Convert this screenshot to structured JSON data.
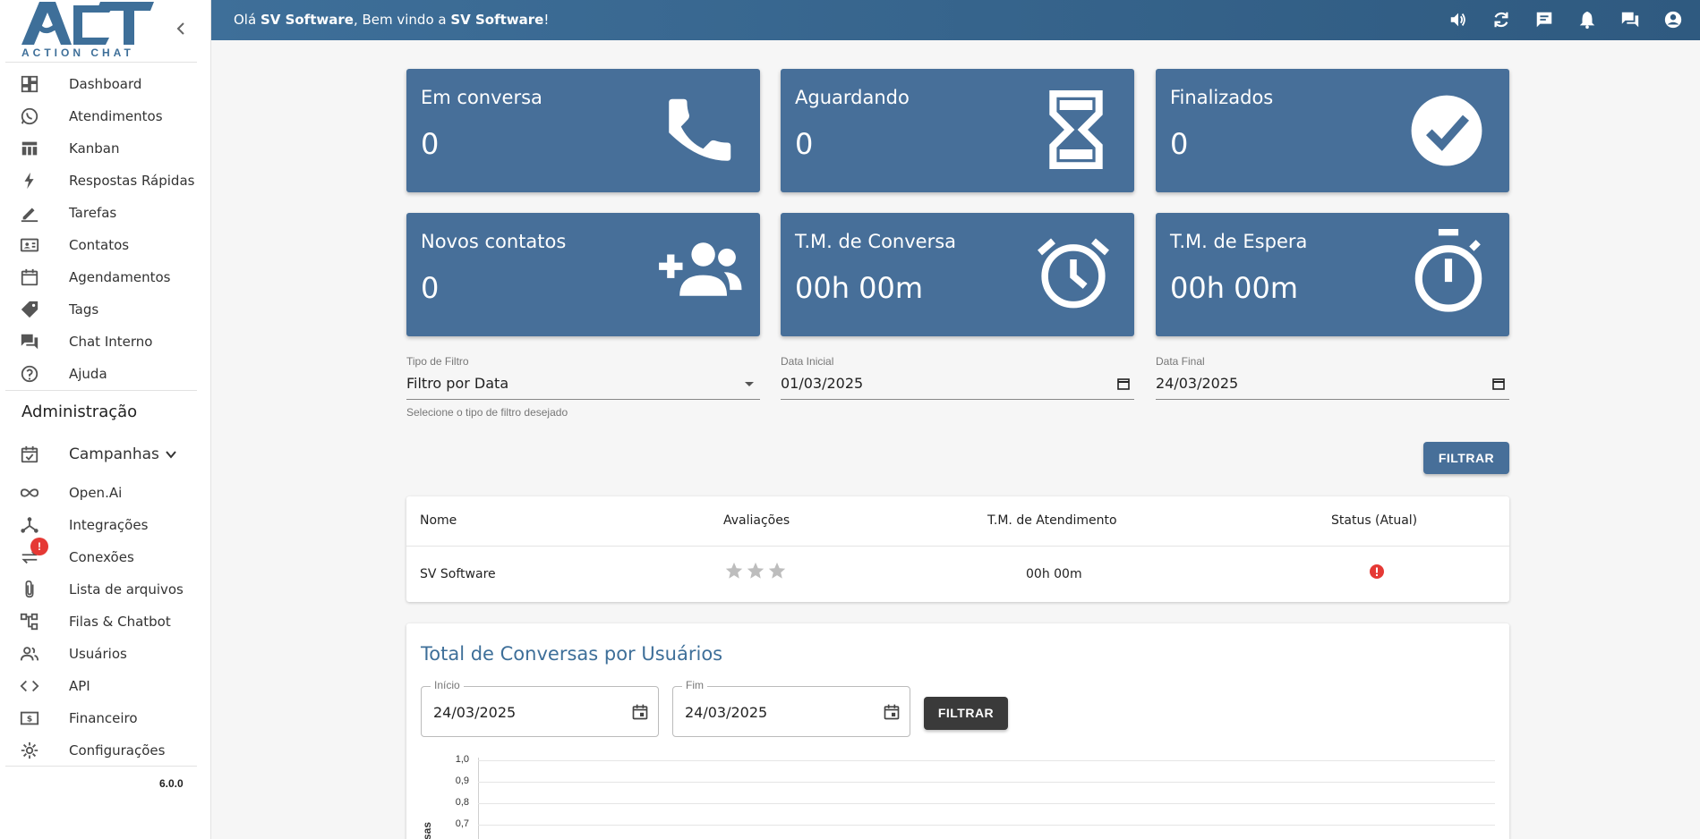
{
  "app": {
    "logo_text": "ACTION CHAT",
    "version": "6.0.0"
  },
  "sidebar": {
    "items": [
      {
        "label": "Dashboard",
        "icon": "dashboard-icon"
      },
      {
        "label": "Atendimentos",
        "icon": "whatsapp-icon"
      },
      {
        "label": "Kanban",
        "icon": "kanban-icon"
      },
      {
        "label": "Respostas Rápidas",
        "icon": "bolt-icon"
      },
      {
        "label": "Tarefas",
        "icon": "pencil-icon"
      },
      {
        "label": "Contatos",
        "icon": "contact-card-icon"
      },
      {
        "label": "Agendamentos",
        "icon": "calendar-icon"
      },
      {
        "label": "Tags",
        "icon": "tag-icon"
      },
      {
        "label": "Chat Interno",
        "icon": "forum-icon"
      },
      {
        "label": "Ajuda",
        "icon": "help-icon"
      }
    ],
    "admin_title": "Administração",
    "admin_items": [
      {
        "label": "Campanhas",
        "icon": "event-check-icon"
      },
      {
        "label": "Open.Ai",
        "icon": "infinity-icon"
      },
      {
        "label": "Integrações",
        "icon": "hub-icon"
      },
      {
        "label": "Conexões",
        "icon": "sync-alt-icon",
        "badge": "!"
      },
      {
        "label": "Lista de arquivos",
        "icon": "paperclip-icon"
      },
      {
        "label": "Filas & Chatbot",
        "icon": "tree-icon"
      },
      {
        "label": "Usuários",
        "icon": "users-icon"
      },
      {
        "label": "API",
        "icon": "code-icon"
      },
      {
        "label": "Financeiro",
        "icon": "money-icon"
      },
      {
        "label": "Configurações",
        "icon": "gear-icon"
      }
    ]
  },
  "topbar": {
    "greeting_prefix": "Olá ",
    "user": "SV Software",
    "greeting_middle": ", Bem vindo a ",
    "company": "SV Software",
    "greeting_suffix": "!",
    "icons": [
      "volume-icon",
      "refresh-icon",
      "message-icon",
      "bell-icon",
      "chat-icon",
      "account-icon"
    ]
  },
  "cards": [
    {
      "title": "Em conversa",
      "value": "0",
      "icon": "phone-icon"
    },
    {
      "title": "Aguardando",
      "value": "0",
      "icon": "hourglass-icon"
    },
    {
      "title": "Finalizados",
      "value": "0",
      "icon": "check-circle-icon"
    },
    {
      "title": "Novos contatos",
      "value": "0",
      "icon": "group-add-icon"
    },
    {
      "title": "T.M. de Conversa",
      "value": "00h 00m",
      "icon": "alarm-icon"
    },
    {
      "title": "T.M. de Espera",
      "value": "00h 00m",
      "icon": "timer-icon"
    }
  ],
  "filters": {
    "type_label": "Tipo de Filtro",
    "type_value": "Filtro por Data",
    "type_helper": "Selecione o tipo de filtro desejado",
    "start_label": "Data Inicial",
    "start_value": "01/03/2025",
    "end_label": "Data Final",
    "end_value": "24/03/2025",
    "button": "FILTRAR"
  },
  "table": {
    "headers": [
      "Nome",
      "Avaliações",
      "T.M. de Atendimento",
      "Status (Atual)"
    ],
    "rows": [
      {
        "name": "SV Software",
        "rating": 0,
        "rating_max": 3,
        "time": "00h 00m",
        "status": "offline"
      }
    ]
  },
  "chart_panel": {
    "title": "Total de Conversas por Usuários",
    "start_label": "Início",
    "start_value": "24/03/2025",
    "end_label": "Fim",
    "end_value": "24/03/2025",
    "button": "FILTRAR",
    "ylabel": "sas"
  },
  "chart_data": {
    "type": "bar",
    "title": "",
    "categories": [],
    "series": [],
    "yticks": [
      "1,0",
      "0,9",
      "0,8",
      "0,7"
    ],
    "ylim": [
      0,
      1
    ]
  },
  "colors": {
    "primary": "#476f99",
    "topbar": "#3e6f99",
    "dark_button": "#3a3a3a",
    "badge": "#e53935"
  }
}
